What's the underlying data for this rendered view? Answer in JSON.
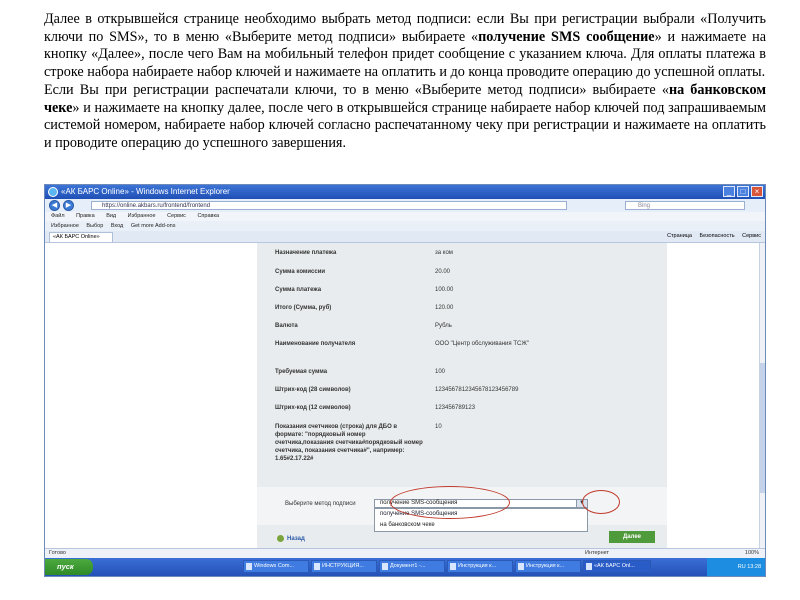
{
  "instructions": {
    "p1_a": "Далее в открывшейся странице необходимо выбрать метод подписи: если Вы при регистрации выбрали «Получить ключи по SMS», то в меню «Выберите метод подписи» выбираете «",
    "p1_bold": "получение SMS сообщение",
    "p1_b": "» и нажимаете на кнопку «Далее», после чего Вам на мобильный телефон придет сообщение с указанием ключа. Для оплаты платежа в строке набора набираете набор ключей и нажимаете на оплатить и до конца проводите операцию до успешной оплаты.",
    "p2_a": "Если Вы при регистрации распечатали ключи, то в меню «Выберите метод подписи» выбираете «",
    "p2_bold": "на банковском чеке",
    "p2_b": "» и нажимаете на кнопку далее, после чего в открывшейся странице набираете набор ключей под запрашиваемым системой номером, набираете набор ключей согласно распечатанному чеку при регистрации и нажимаете на оплатить и проводите операцию до успешного завершения."
  },
  "browser": {
    "title": "«АК БАРС Online» - Windows Internet Explorer",
    "url": "https://online.akbars.ru/frontend/frontend",
    "search_placeholder": "Bing",
    "menu": [
      "Файл",
      "Правка",
      "Вид",
      "Избранное",
      "Сервис",
      "Справка"
    ],
    "favorites": [
      "Избранное",
      "Выбор",
      "Вход",
      "Get more Add-ons"
    ],
    "tab": "«АК БАРС Online»",
    "commands": [
      "Страница",
      "Безопасность",
      "Сервис"
    ]
  },
  "payment": {
    "rows": [
      {
        "label": "Назначение платежа",
        "value": "за ком"
      },
      {
        "label": "Сумма комиссии",
        "value": "20.00"
      },
      {
        "label": "Сумма платежа",
        "value": "100.00"
      },
      {
        "label": "Итого (Сумма, руб)",
        "value": "120.00"
      },
      {
        "label": "Валюта",
        "value": "Рубль"
      },
      {
        "label": "Наименование получателя",
        "value": "ООО \"Центр обслуживания ТСЖ\""
      },
      {
        "label": "Требуемая сумма",
        "value": "100"
      },
      {
        "label": "Штрих-код (28 символов)",
        "value": "1234567812345678123456789"
      },
      {
        "label": "Штрих-код (12 символов)",
        "value": "123456789123"
      },
      {
        "label": "Показания счетчиков (строка) для ДБО в формате: \"порядковый номер счетчика,показания счетчика#порядковый номер счетчика, показания счетчика#\", например: 1.65#2.17.22#",
        "value": "10"
      }
    ],
    "method_label": "Выберите метод подписи",
    "method_selected": "получение SMS-сообщения",
    "method_options": [
      "получение SMS-сообщения",
      "на банковском чеке"
    ],
    "back_label": "Назад",
    "next_label": "Далее"
  },
  "status": {
    "left": "Готово",
    "zone": "Интернет",
    "zoom": "100%"
  },
  "taskbar": {
    "start": "пуск",
    "items": [
      "Windows Com...",
      "ИНСТРУКЦИЯ...",
      "Документ1 -...",
      "Инструкция к...",
      "Инструкция к...",
      "«АК БАРС Onl..."
    ],
    "lang": "RU",
    "clock": "13:28"
  }
}
